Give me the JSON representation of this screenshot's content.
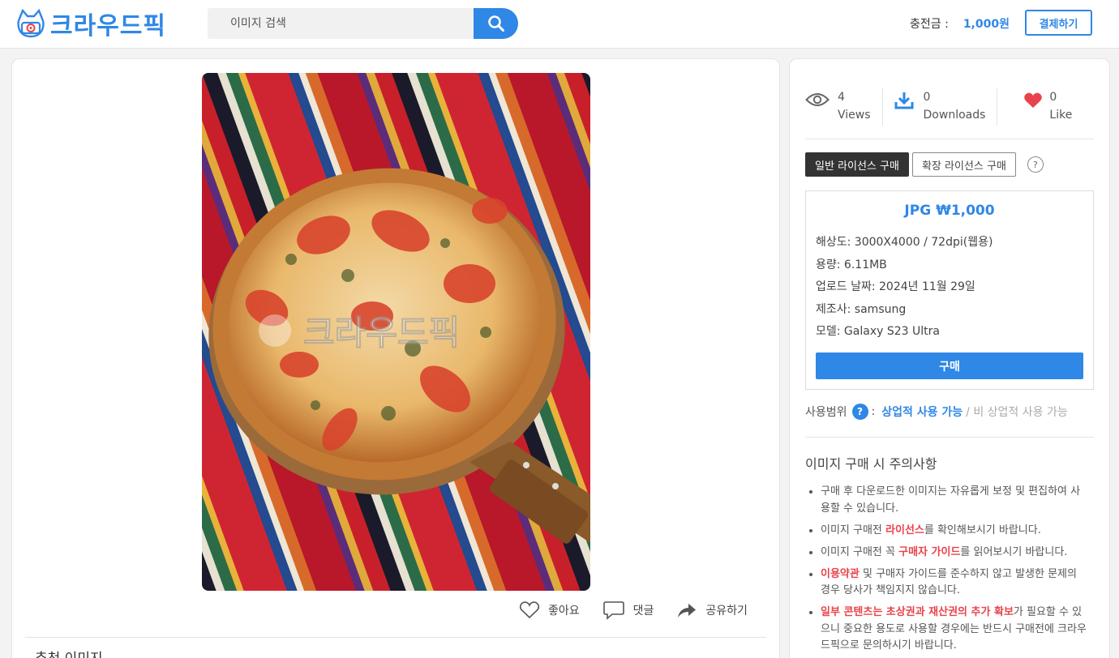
{
  "header": {
    "logo_text": "크라우드픽",
    "search_placeholder": "이미지 검색",
    "balance_label": "충전금 :",
    "balance_value": "1,000원",
    "pay_label": "결제하기"
  },
  "main": {
    "watermark_text": "크라우드픽",
    "actions": {
      "like": "좋아요",
      "comment": "댓글",
      "share": "공유하기"
    },
    "recommended_title": "추천 이미지"
  },
  "side": {
    "stats": {
      "views_count": "4",
      "views_label": "Views",
      "downloads_count": "0",
      "downloads_label": "Downloads",
      "likes_count": "0",
      "likes_label": "Like"
    },
    "tabs": {
      "standard": "일반 라이선스 구매",
      "extended": "확장 라이선스 구매",
      "help": "?"
    },
    "price": "JPG ₩1,000",
    "specs": {
      "resolution": "해상도: 3000X4000 / 72dpi(웹용)",
      "size": "용량: 6.11MB",
      "upload_date": "업로드 날짜: 2024년 11월 29일",
      "maker": "제조사: samsung",
      "model": "모델: Galaxy S23 Ultra"
    },
    "buy_label": "구매",
    "usage": {
      "label": "사용범위",
      "help": "?",
      "colon": ":",
      "commercial": "상업적 사용 가능",
      "non_commercial": "/ 비 상업적 사용 가능"
    },
    "notice": {
      "title": "이미지 구매 시 주의사항",
      "item1": "구매 후 다운로드한 이미지는 자유롭게 보정 및 편집하여 사용할 수 있습니다.",
      "item2_pre": "이미지 구매전 ",
      "item2_highlight": "라이선스",
      "item2_post": "를 확인해보시기 바랍니다.",
      "item3_pre": "이미지 구매전 꼭 ",
      "item3_highlight": "구매자 가이드",
      "item3_post": "를 읽어보시기 바랍니다.",
      "item4_highlight": "이용약관",
      "item4_post": " 및 구매자 가이드를 준수하지 않고 발생한 문제의 경우 당사가 책임지지 않습니다.",
      "item5_highlight": "일부 콘텐츠는 초상권과 재산권의 추가 확보",
      "item5_post": "가 필요할 수 있으니 중요한 용도로 사용할 경우에는 반드시 구매전에 크라우드픽으로 문의하시기 바랍니다."
    }
  },
  "colors": {
    "accent": "#2f87e6",
    "highlight": "#e8434a",
    "heart": "#e8434a"
  }
}
